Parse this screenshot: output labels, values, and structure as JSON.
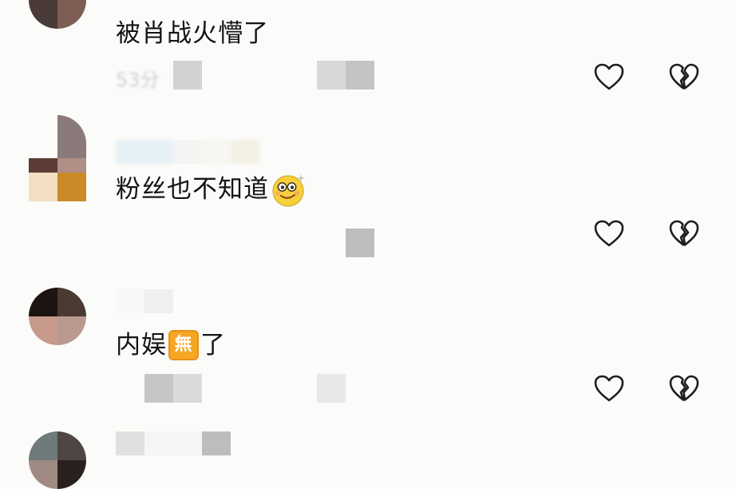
{
  "comments": [
    {
      "text_before": "被肖战火懵了",
      "text_after": "",
      "meta_visible": "53分"
    },
    {
      "text_before": "粉丝也不知道",
      "text_after": "",
      "emoji": "dizzy-smile-emoji"
    },
    {
      "text_before": "内娱",
      "badge": "無",
      "text_after": "了"
    }
  ],
  "icons": {
    "like": "heart-outline-icon",
    "dislike": "broken-heart-icon"
  },
  "colors": {
    "background": "#fbfbf9",
    "text": "#141414",
    "icon_stroke": "#1e1e1e",
    "badge": "#f5a623",
    "emoji_face": "#f7d13c"
  }
}
